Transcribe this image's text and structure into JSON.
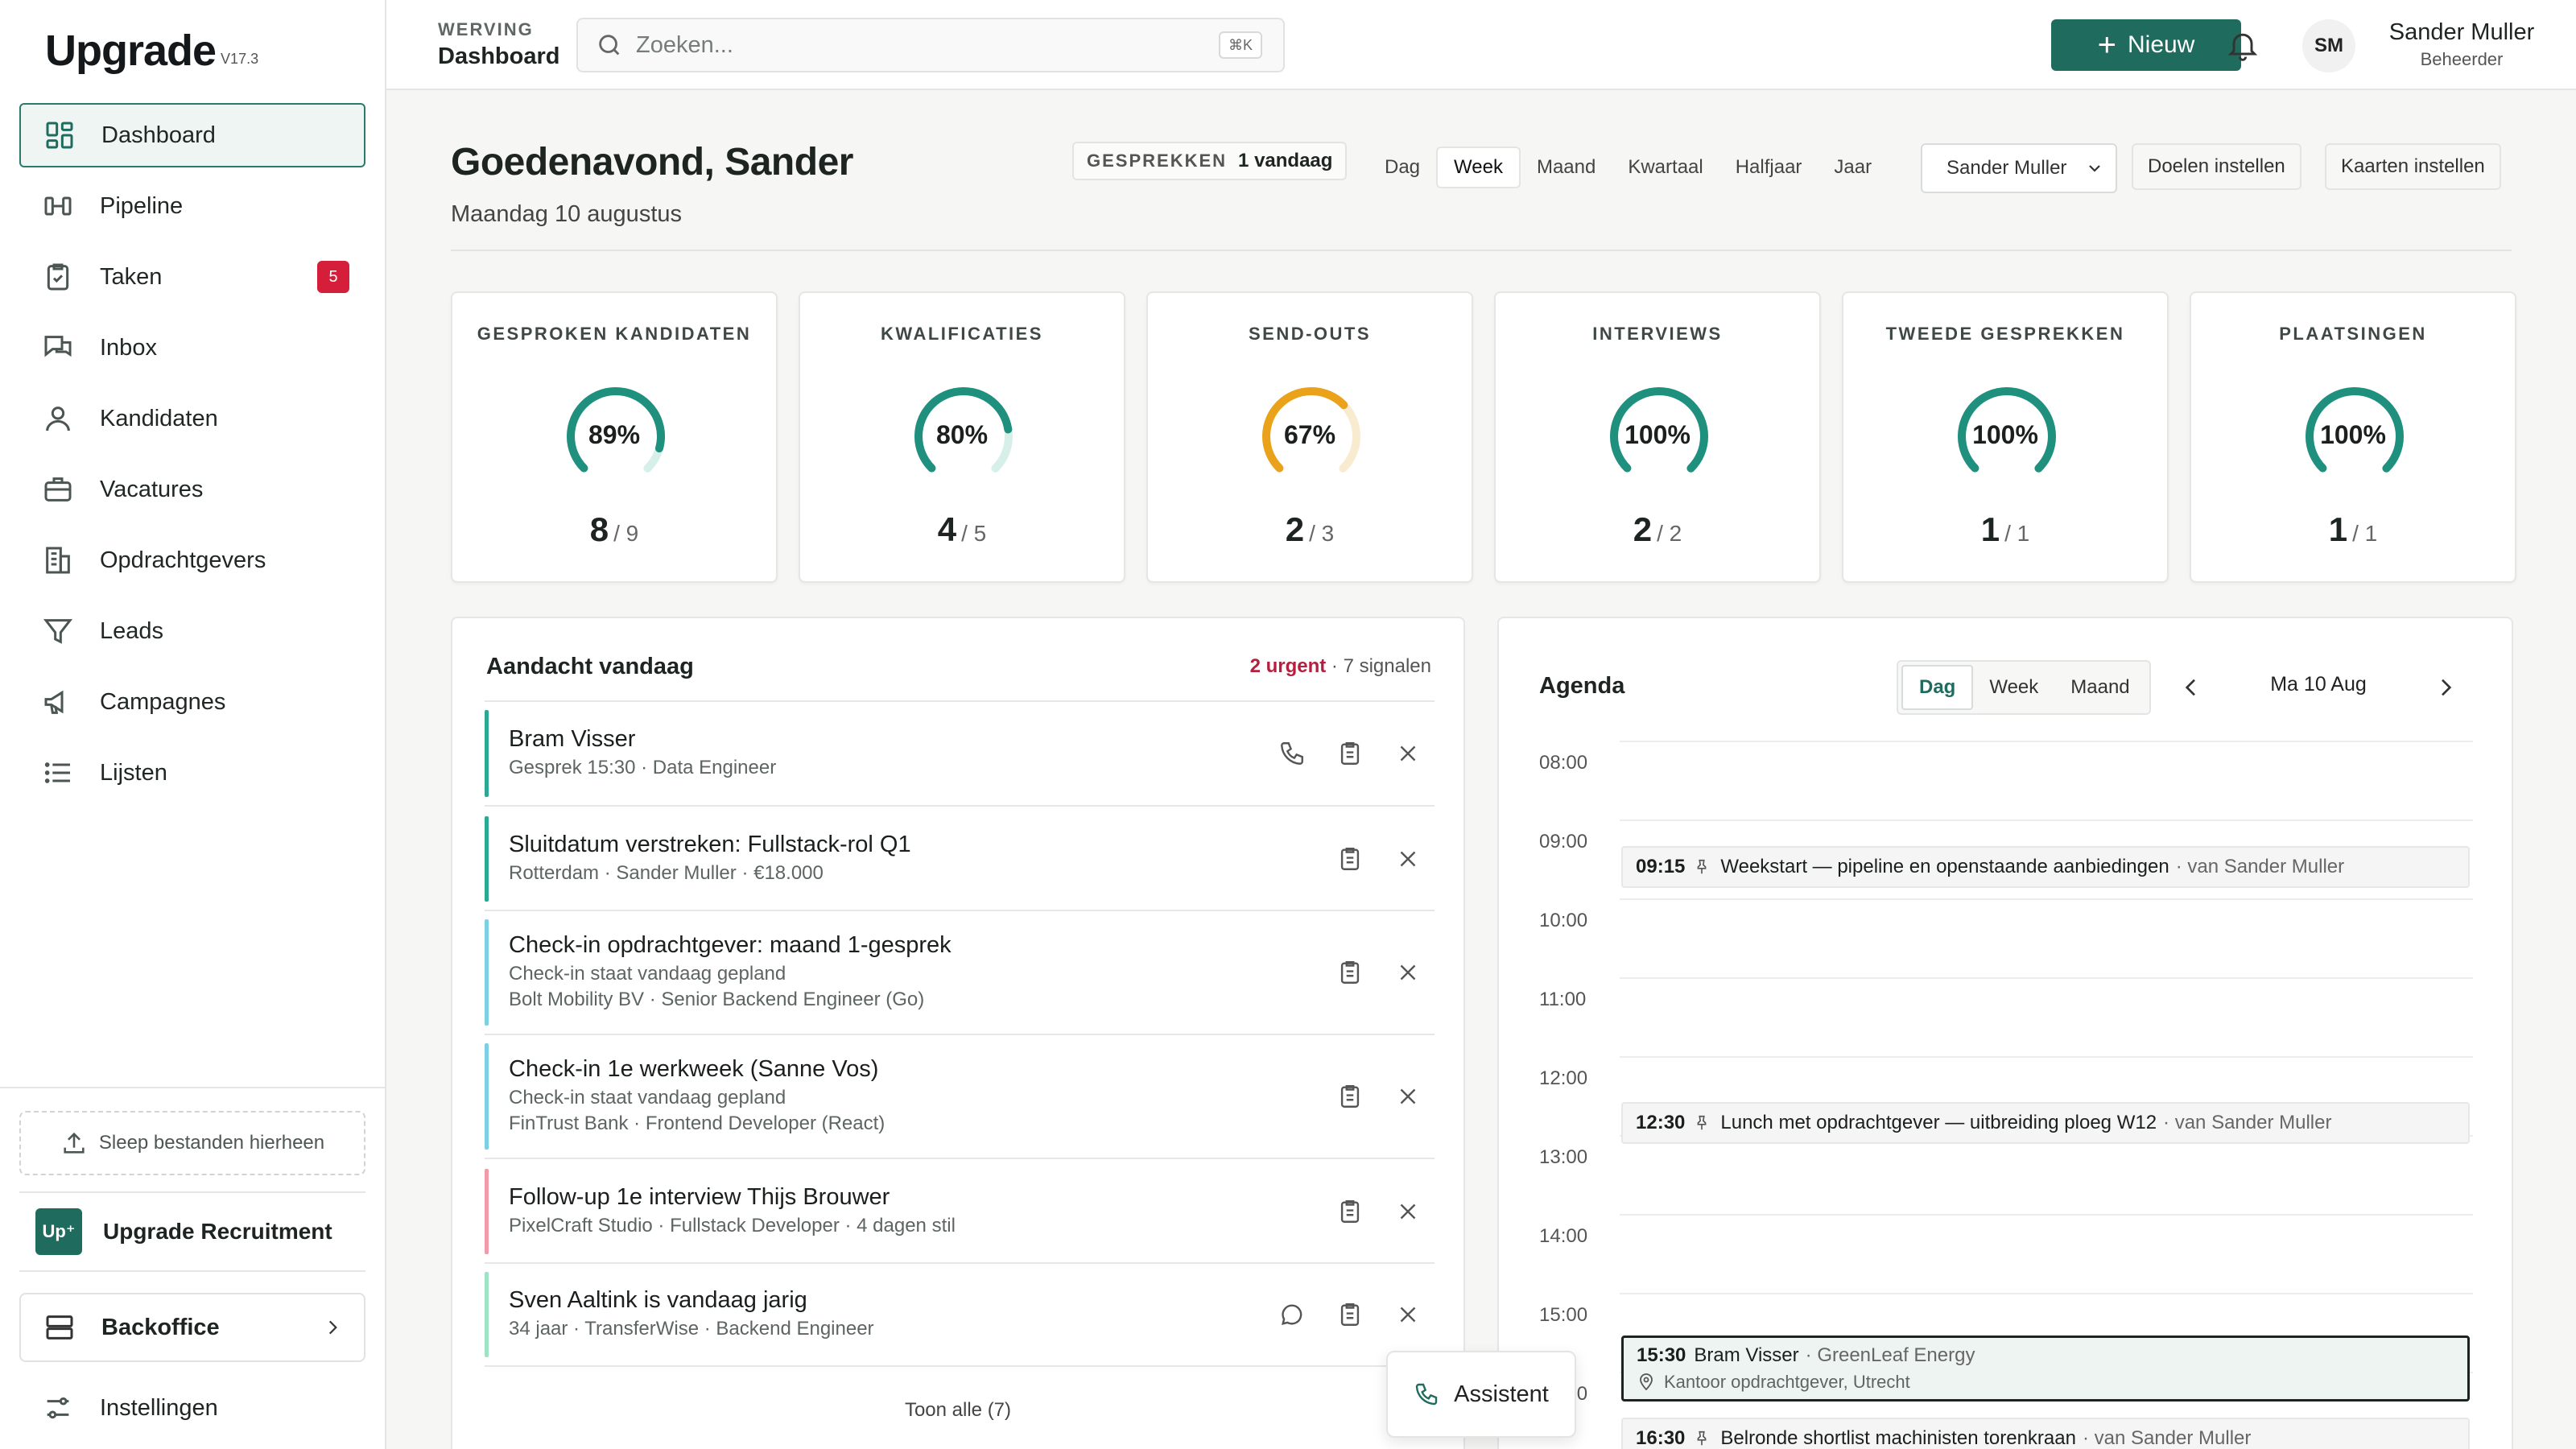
{
  "brand": {
    "name": "Upgrade",
    "version": "V17.3"
  },
  "sidebar": {
    "items": [
      {
        "label": "Dashboard",
        "icon": "dashboard-grid-icon",
        "active": true
      },
      {
        "label": "Pipeline",
        "icon": "pipeline-icon"
      },
      {
        "label": "Taken",
        "icon": "clipboard-check-icon",
        "badge": "5"
      },
      {
        "label": "Inbox",
        "icon": "inbox-chat-icon"
      },
      {
        "label": "Kandidaten",
        "icon": "user-icon"
      },
      {
        "label": "Vacatures",
        "icon": "briefcase-icon"
      },
      {
        "label": "Opdrachtgevers",
        "icon": "building-icon"
      },
      {
        "label": "Leads",
        "icon": "funnel-icon"
      },
      {
        "label": "Campagnes",
        "icon": "megaphone-icon"
      },
      {
        "label": "Lijsten",
        "icon": "list-icon"
      }
    ],
    "dropzone": "Sleep bestanden hierheen",
    "org": {
      "logo": "Up⁺",
      "name": "Upgrade Recruitment"
    },
    "backoffice": "Backoffice",
    "settings": "Instellingen"
  },
  "topbar": {
    "section": "WERVING",
    "page": "Dashboard",
    "search_placeholder": "Zoeken...",
    "shortcut": "⌘K",
    "new_button": "Nieuw",
    "user": {
      "initials": "SM",
      "name": "Sander Muller",
      "role": "Beheerder"
    }
  },
  "header": {
    "greeting": "Goedenavond, Sander",
    "date": "Maandag 10 augustus",
    "pill_label": "GESPREKKEN",
    "pill_value": "1 vandaag",
    "periods": [
      "Dag",
      "Week",
      "Maand",
      "Kwartaal",
      "Halfjaar",
      "Jaar"
    ],
    "active_period": "Week",
    "owner": "Sander Muller",
    "goals_button": "Doelen instellen",
    "cards_button": "Kaarten instellen"
  },
  "kpis": [
    {
      "title": "GESPROKEN KANDIDATEN",
      "pct": "89%",
      "value": "8",
      "target": "/ 9",
      "fraction": 0.89,
      "color": "#1f8f7e",
      "track": "#d7efe9"
    },
    {
      "title": "KWALIFICATIES",
      "pct": "80%",
      "value": "4",
      "target": "/ 5",
      "fraction": 0.8,
      "color": "#1f8f7e",
      "track": "#d7efe9"
    },
    {
      "title": "SEND-OUTS",
      "pct": "67%",
      "value": "2",
      "target": "/ 3",
      "fraction": 0.67,
      "color": "#eaa21b",
      "track": "#f8ebcf"
    },
    {
      "title": "INTERVIEWS",
      "pct": "100%",
      "value": "2",
      "target": "/ 2",
      "fraction": 1.0,
      "color": "#1f8f7e",
      "track": "#d7efe9"
    },
    {
      "title": "TWEEDE GESPREKKEN",
      "pct": "100%",
      "value": "1",
      "target": "/ 1",
      "fraction": 1.0,
      "color": "#1f8f7e",
      "track": "#d7efe9"
    },
    {
      "title": "PLAATSINGEN",
      "pct": "100%",
      "value": "1",
      "target": "/ 1",
      "fraction": 1.0,
      "color": "#1f8f7e",
      "track": "#d7efe9"
    }
  ],
  "attention": {
    "title": "Aandacht vandaag",
    "urgent": "2 urgent",
    "signals": "· 7 signalen",
    "items": [
      {
        "title": "Bram Visser",
        "lines": [
          "Gesprek 15:30 · Data Engineer"
        ],
        "bar": "#2aa894",
        "actions": [
          "phone-icon",
          "clipboard-icon",
          "close-icon"
        ]
      },
      {
        "title": "Sluitdatum verstreken: Fullstack-rol Q1",
        "lines": [
          "Rotterdam · Sander Muller · €18.000"
        ],
        "bar": "#2aa894",
        "actions": [
          "clipboard-icon",
          "close-icon"
        ]
      },
      {
        "title": "Check-in opdrachtgever: maand 1-gesprek",
        "lines": [
          "Check-in staat vandaag gepland",
          "Bolt Mobility BV · Senior Backend Engineer (Go)"
        ],
        "bar": "#7dd0e3",
        "actions": [
          "clipboard-icon",
          "close-icon"
        ]
      },
      {
        "title": "Check-in 1e werkweek (Sanne Vos)",
        "lines": [
          "Check-in staat vandaag gepland",
          "FinTrust Bank · Frontend Developer (React)"
        ],
        "bar": "#7dd0e3",
        "actions": [
          "clipboard-icon",
          "close-icon"
        ]
      },
      {
        "title": "Follow-up 1e interview Thijs Brouwer",
        "lines": [
          "PixelCraft Studio · Fullstack Developer · 4 dagen stil"
        ],
        "bar": "#f29aa7",
        "actions": [
          "clipboard-icon",
          "close-icon"
        ]
      },
      {
        "title": "Sven Aaltink is vandaag jarig",
        "lines": [
          "34 jaar · TransferWise · Backend Engineer"
        ],
        "bar": "#9fe3c4",
        "actions": [
          "chat-icon",
          "clipboard-icon",
          "close-icon"
        ]
      }
    ],
    "show_all": "Toon alle (7)"
  },
  "agenda": {
    "title": "Agenda",
    "views": [
      "Dag",
      "Week",
      "Maand"
    ],
    "active_view": "Dag",
    "day": "Ma 10 Aug",
    "hours": [
      "08:00",
      "09:00",
      "10:00",
      "11:00",
      "12:00",
      "13:00",
      "14:00",
      "15:00",
      "16:00"
    ],
    "events": [
      {
        "time": "09:15",
        "title": "Weekstart — pipeline en openstaande aanbiedingen",
        "by": "· van Sander Muller",
        "pinned": true
      },
      {
        "time": "12:30",
        "title": "Lunch met opdrachtgever — uitbreiding ploeg W12",
        "by": "· van Sander Muller",
        "pinned": true
      },
      {
        "time": "15:30",
        "title": "Bram Visser",
        "by": "· GreenLeaf Energy",
        "location": "Kantoor opdrachtgever, Utrecht",
        "highlight": true
      },
      {
        "time": "16:30",
        "title": "Belronde shortlist machinisten torenkraan",
        "by": "· van Sander Muller",
        "pinned": true
      }
    ]
  },
  "assistant": "Assistent"
}
